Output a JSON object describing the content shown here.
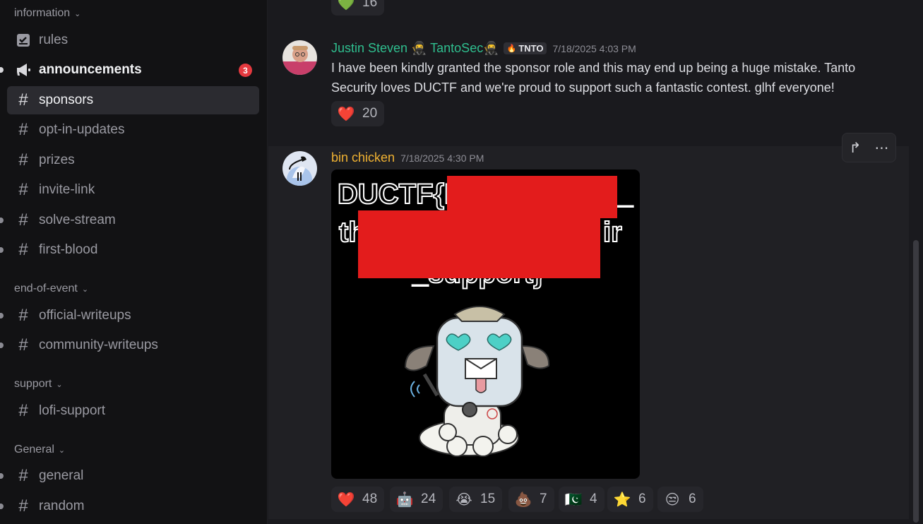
{
  "sidebar": {
    "categories": [
      {
        "label": "information"
      },
      {
        "label": "end-of-event"
      },
      {
        "label": "support"
      },
      {
        "label": "General"
      }
    ],
    "channels": [
      {
        "label": "rules",
        "icon": "rules-icon"
      },
      {
        "label": "announcements",
        "icon": "megaphone-icon",
        "badge": "3"
      },
      {
        "label": "sponsors",
        "icon": "hash-icon"
      },
      {
        "label": "opt-in-updates",
        "icon": "hash-icon"
      },
      {
        "label": "prizes",
        "icon": "hash-icon"
      },
      {
        "label": "invite-link",
        "icon": "hash-icon"
      },
      {
        "label": "solve-stream",
        "icon": "hash-icon"
      },
      {
        "label": "first-blood",
        "icon": "hash-icon"
      },
      {
        "label": "official-writeups",
        "icon": "hash-icon"
      },
      {
        "label": "community-writeups",
        "icon": "hash-icon"
      },
      {
        "label": "lofi-support",
        "icon": "hash-icon"
      },
      {
        "label": "general",
        "icon": "hash-icon"
      },
      {
        "label": "random",
        "icon": "hash-icon"
      }
    ]
  },
  "messages": {
    "top_reaction": {
      "emoji": "💚",
      "count": "16"
    },
    "justin": {
      "author": "Justin Steven 🥷 TantoSec🥷",
      "tag": "TNTO",
      "tag_icon": "🔥",
      "timestamp": "7/18/2025 4:03 PM",
      "text_line1": "I have been kindly granted the sponsor role and this may end up being a huge mistake. Tanto",
      "text_line2": "Security loves DUCTF and we're proud to support such a fantastic contest. glhf everyone!",
      "reaction": {
        "emoji": "❤️",
        "count": "20"
      }
    },
    "bin": {
      "author": "bin chicken",
      "timestamp": "7/18/2025 4:30 PM",
      "image_text_line1": "DUCTF{E",
      "image_text_line1_end": "_",
      "image_text_line2": "th",
      "image_text_line2_end": "ir",
      "image_text_line3": "_support}",
      "reactions": [
        {
          "emoji": "❤️",
          "count": "48"
        },
        {
          "emoji": "🤖",
          "count": "24"
        },
        {
          "emoji": "😭",
          "count": "15"
        },
        {
          "emoji": "💩",
          "count": "7"
        },
        {
          "emoji": "🇵🇰",
          "count": "4"
        },
        {
          "emoji": "⭐",
          "count": "6"
        },
        {
          "emoji": "😒",
          "count": "6"
        }
      ]
    }
  },
  "toolbar": {
    "forward_icon": "forward-icon",
    "more_icon": "more-icon",
    "more_glyph": "⋯",
    "forward_glyph": "↱"
  },
  "colors": {
    "justin_name": "#2fbf8f",
    "bin_name": "#f0b232",
    "badge": "#e5393f",
    "redaction": "#e31c1c"
  }
}
